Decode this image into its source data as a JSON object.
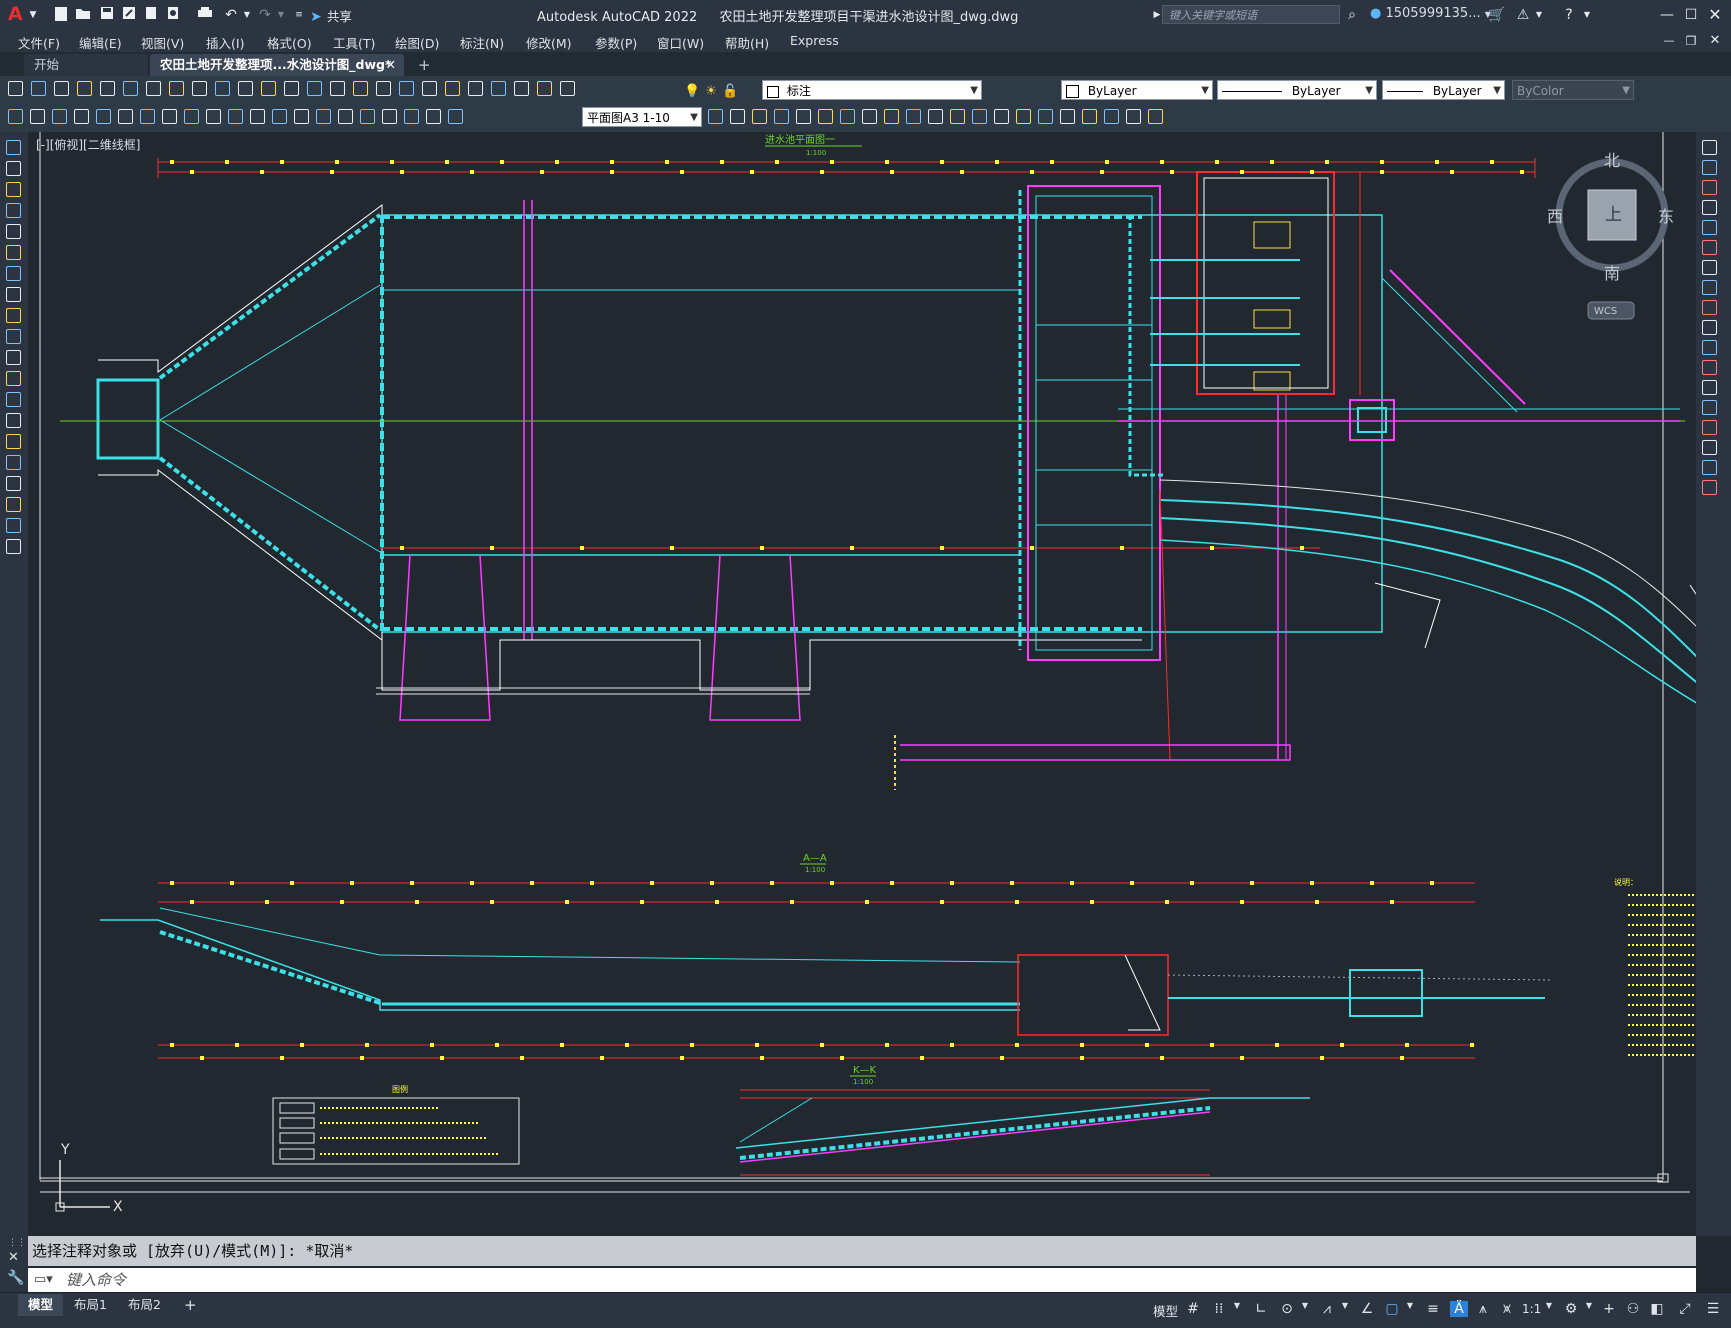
{
  "app": {
    "title": "Autodesk AutoCAD 2022",
    "filename": "农田土地开发整理项目干渠进水池设计图_dwg.dwg",
    "share_label": "共享",
    "search_placeholder": "键入关键字或短语",
    "user": "1505999135...",
    "accent": "#e0312f"
  },
  "menu": [
    "文件(F)",
    "编辑(E)",
    "视图(V)",
    "插入(I)",
    "格式(O)",
    "工具(T)",
    "绘图(D)",
    "标注(N)",
    "修改(M)",
    "参数(P)",
    "窗口(W)",
    "帮助(H)",
    "Express"
  ],
  "tabs": [
    {
      "label": "开始",
      "active": false
    },
    {
      "label": "农田土地开发整理项...水池设计图_dwg*",
      "active": true
    }
  ],
  "toolbar": {
    "layer": "标注",
    "color": "ByLayer",
    "linetype": "ByLayer",
    "lineweight": "ByLayer",
    "plotstyle": "ByColor",
    "annoscale": "平面图A3 1-10"
  },
  "viewport": {
    "label": "[-][俯视][二维线框]",
    "viewcube": {
      "north": "北",
      "south": "南",
      "east": "东",
      "west": "西",
      "face": "上",
      "ucs": "WCS"
    }
  },
  "drawing": {
    "plan_title": "进水池平面图一",
    "plan_scale": "1:100",
    "section_aa_title": "A—A",
    "section_aa_scale": "1:100",
    "section_kk_title": "K—K",
    "section_kk_scale": "1:100",
    "legend_title": "图例",
    "notes_title": "说明：",
    "ucs_y": "Y",
    "ucs_x": "X"
  },
  "command": {
    "history": "选择注释对象或 [放弃(U)/模式(M)]: *取消*",
    "input_placeholder": "键入命令"
  },
  "layout_tabs": [
    {
      "label": "模型",
      "active": true
    },
    {
      "label": "布局1",
      "active": false
    },
    {
      "label": "布局2",
      "active": false
    }
  ],
  "status": {
    "model_label": "模型",
    "scale": "1:1"
  }
}
